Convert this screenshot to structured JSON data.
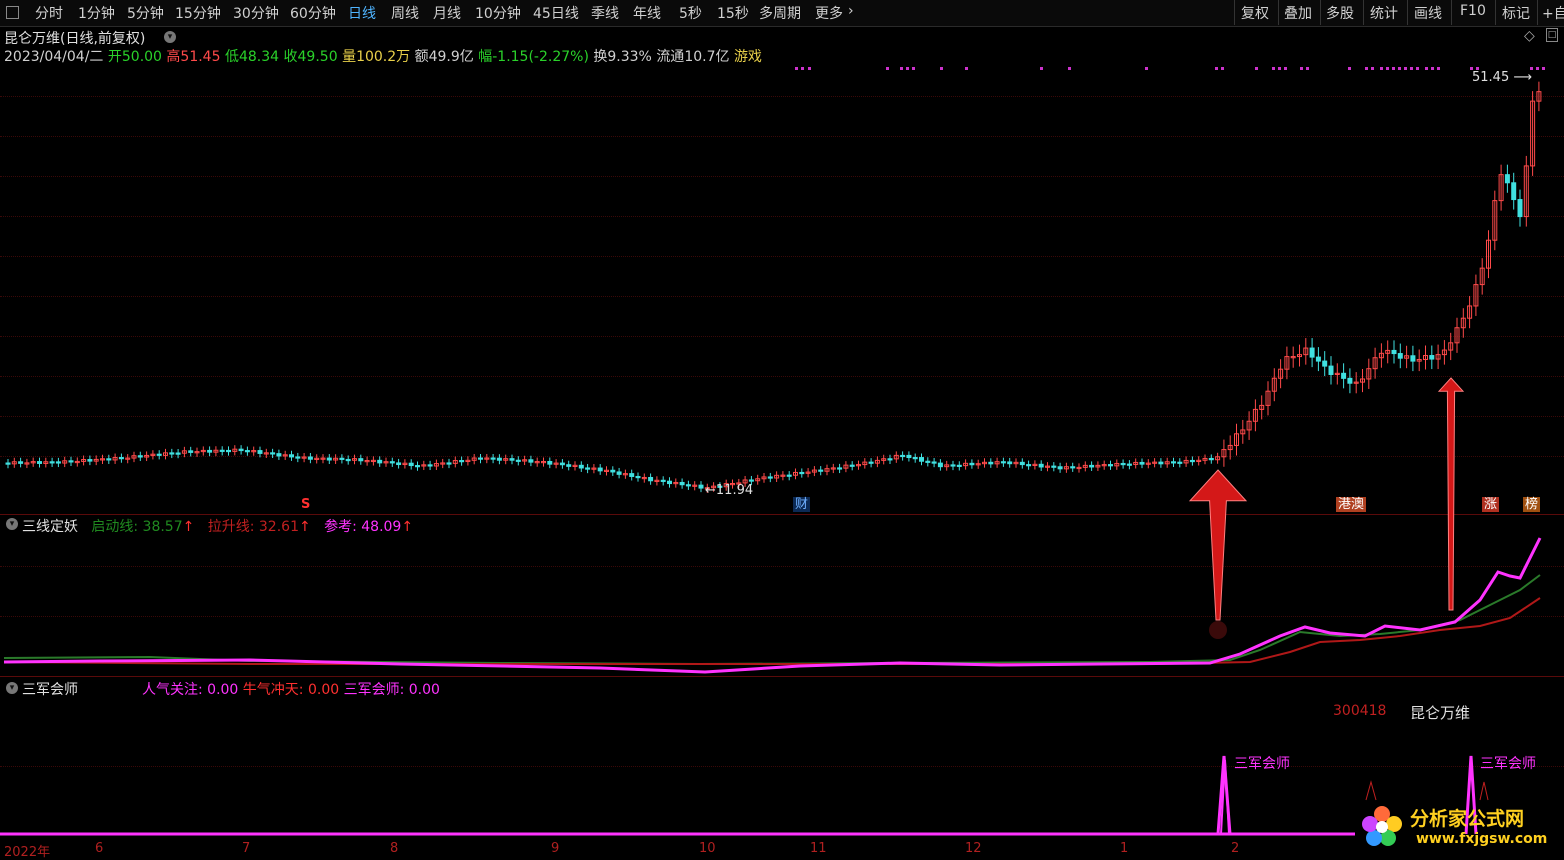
{
  "toolbar": {
    "periods": [
      "分时",
      "1分钟",
      "5分钟",
      "15分钟",
      "30分钟",
      "60分钟",
      "日线",
      "周线",
      "月线",
      "10分钟",
      "45日线",
      "季线",
      "年线",
      "5秒",
      "15秒",
      "多周期",
      "更多"
    ],
    "active_period": "日线",
    "right_items": [
      "复权",
      "叠加",
      "多股",
      "统计",
      "画线",
      "F10",
      "标记",
      "+自"
    ]
  },
  "header": {
    "title": "昆仑万维(日线,前复权)",
    "date": "2023/04/04/二",
    "open_label": "开",
    "open": "50.00",
    "high_label": "高",
    "high": "51.45",
    "low_label": "低",
    "low": "48.34",
    "close_label": "收",
    "close": "49.50",
    "volume_label": "量",
    "volume": "100.2万",
    "amount_label": "额",
    "amount": "49.9亿",
    "change_label": "幅",
    "change": "-1.15(-2.27%)",
    "turnover_label": "换",
    "turnover": "9.33%",
    "float_label": "流通",
    "float": "10.7亿",
    "sector": "游戏"
  },
  "main_chart": {
    "high_mark": "51.45",
    "low_mark": "11.94",
    "markers": [
      "S",
      "财",
      "港澳",
      "涨",
      "榜"
    ]
  },
  "indicator1": {
    "name": "三线定妖",
    "line1_label": "启动线:",
    "line1_value": "38.57",
    "line2_label": "拉升线:",
    "line2_value": "32.61",
    "line3_label": "参考:",
    "line3_value": "48.09"
  },
  "indicator2": {
    "name": "三军会师",
    "v1_label": "人气关注:",
    "v1_value": "0.00",
    "v2_label": "牛气冲天:",
    "v2_value": "0.00",
    "v3_label": "三军会师:",
    "v3_value": "0.00",
    "stock_code": "300418",
    "stock_name": "昆仑万维",
    "signal_label": "三军会师"
  },
  "x_axis": [
    "2022年",
    "6",
    "7",
    "8",
    "9",
    "10",
    "11",
    "12",
    "1",
    "2"
  ],
  "watermark": {
    "name": "分析家公式网",
    "url": "www.fxjgsw.com"
  },
  "colors": {
    "up": "#ff4a4a",
    "down": "#40e0e0",
    "pink": "#ff33ff",
    "green": "#2a8a2a",
    "darkred": "#c01818"
  }
}
